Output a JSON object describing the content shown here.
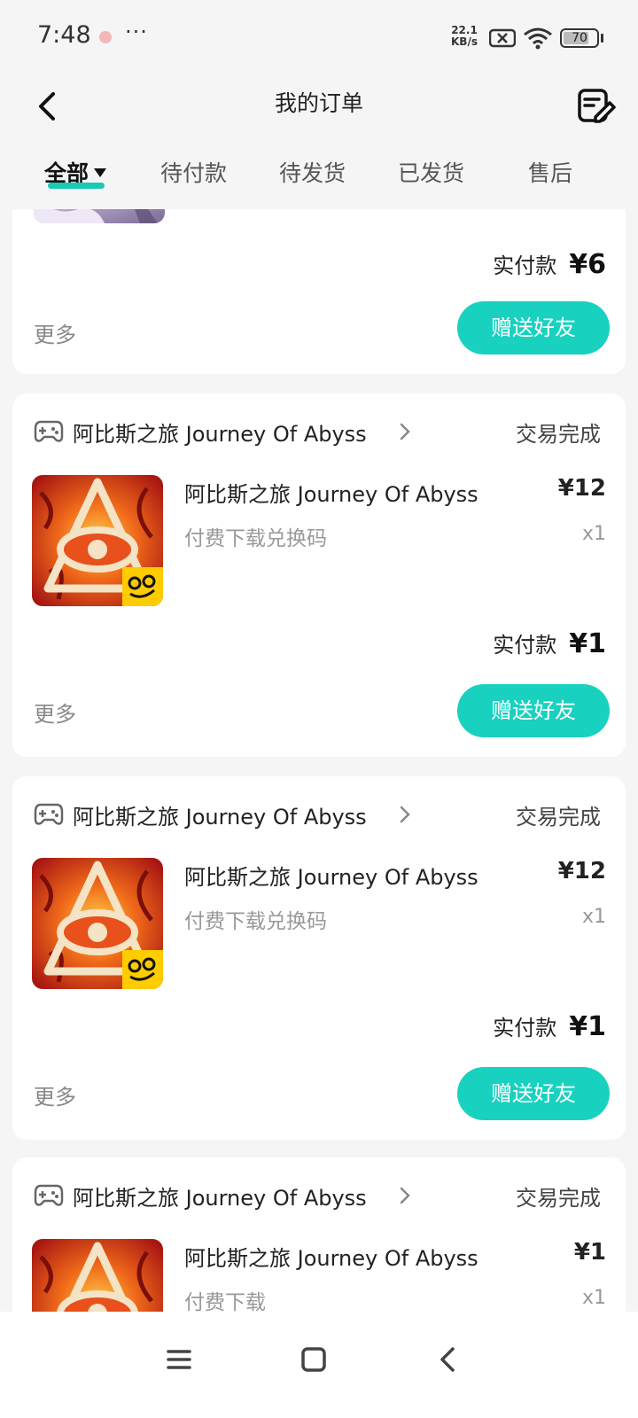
{
  "status_bar": {
    "time": "7:48",
    "more": "···",
    "speed_value": "22.1",
    "speed_unit": "KB/s",
    "battery": "70"
  },
  "header": {
    "title": "我的订单",
    "back_icon": "back-arrow-icon",
    "edit_icon": "edit-order-icon"
  },
  "tabs": [
    {
      "label": "全部",
      "active": true
    },
    {
      "label": "待付款"
    },
    {
      "label": "待发货"
    },
    {
      "label": "已发货"
    },
    {
      "label": "售后"
    }
  ],
  "partial_order": {
    "paid_label": "实付款",
    "paid_amount": "¥6",
    "more": "更多",
    "gift_button": "赠送好友"
  },
  "orders": [
    {
      "shop": "阿比斯之旅 Journey Of Abyss",
      "status": "交易完成",
      "item_name": "阿比斯之旅 Journey Of Abyss",
      "item_sub": "付费下载兑换码",
      "price": "¥12",
      "qty": "x1",
      "paid_label": "实付款",
      "paid_amount": "¥1",
      "more": "更多",
      "gift_button": "赠送好友"
    },
    {
      "shop": "阿比斯之旅 Journey Of Abyss",
      "status": "交易完成",
      "item_name": "阿比斯之旅 Journey Of Abyss",
      "item_sub": "付费下载兑换码",
      "price": "¥12",
      "qty": "x1",
      "paid_label": "实付款",
      "paid_amount": "¥1",
      "more": "更多",
      "gift_button": "赠送好友"
    },
    {
      "shop": "阿比斯之旅 Journey Of Abyss",
      "status": "交易完成",
      "item_name": "阿比斯之旅 Journey Of Abyss",
      "item_sub": "付费下载",
      "price": "¥1",
      "qty": "x1"
    }
  ],
  "colors": {
    "accent": "#19d1bf",
    "background": "#f5f5f5"
  }
}
